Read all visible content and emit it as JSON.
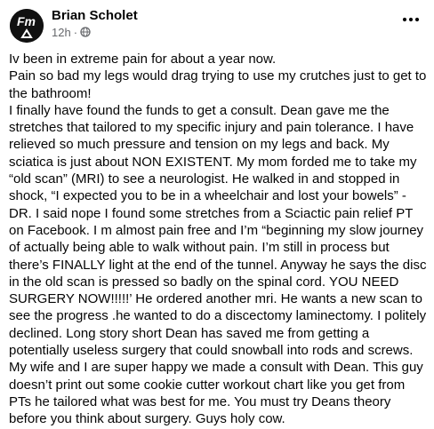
{
  "post": {
    "author": "Brian Scholet",
    "timestamp": "12h",
    "separator": "·",
    "audience_icon": "globe-icon",
    "more_icon": "more-options-icon",
    "avatar_text": "Fm",
    "paragraphs": [
      "Iv been in extreme pain for about a year now.",
      "Pain so bad my legs would drag trying to use my crutches just to get to the bathroom!",
      "I finally have found the funds to get a consult. Dean gave me the stretches that tailored to my specific injury and pain tolerance. I have relieved so much pressure and tension on my legs and back. My sciatica is just about NON EXISTENT. My mom forded me to take my “old scan” (MRI) to see a neurologist. He walked in and stopped in shock, “I expected you to be in a wheelchair and lost your bowels” - DR. I said nope I found some stretches from a Sciactic pain relief PT on Facebook. I m almost pain free and I’m “beginning my slow journey of actually being able to walk without pain. I’m still in process but there’s FINALLY light at the end of the tunnel. Anyway he says the disc in the old scan is pressed so badly on the spinal cord. YOU NEED SURGERY NOW!!!!!’ He ordered another mri. He wants a new scan to see the progress .he wanted to do a discectomy laminectomy. I politely declined. Long story short Dean has saved me from getting a potentially useless surgery that could snowball into rods and screws. My wife and I are super happy we made a consult with Dean. This guy doesn’t print out some cookie cutter workout chart like you get from PTs he tailored what was best for me. You must try Deans theory before you think about surgery. Guys holy cow."
    ]
  }
}
